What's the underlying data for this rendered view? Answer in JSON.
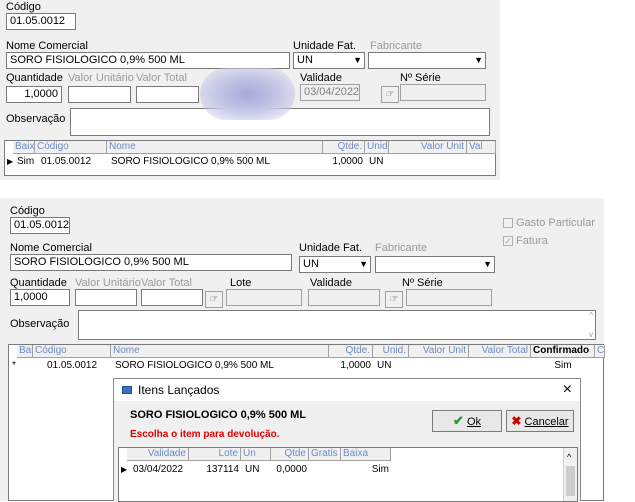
{
  "screen1": {
    "codigo_label": "Código",
    "codigo_value": "01.05.0012",
    "nome_label": "Nome Comercial",
    "nome_value": "SORO FISIOLOGICO 0,9% 500 ML",
    "unidade_label": "Unidade Fat.",
    "unidade_value": "UN",
    "fabricante_label": "Fabricante",
    "quantidade_label": "Quantidade",
    "quantidade_value": "1,0000",
    "valor_unit_label": "Valor Unitário",
    "valor_total_label": "Valor Total",
    "validade_label": "Validade",
    "validade_value": "03/04/2022",
    "serie_label": "Nº Série",
    "observacao_label": "Observação",
    "grid_headers": [
      "Baixa",
      "Código",
      "Nome",
      "Qtde.",
      "Unid.",
      "Valor Unit",
      "Val"
    ],
    "grid_row": [
      "Sim",
      "01.05.0012",
      "SORO FISIOLOGICO 0,9% 500 ML",
      "1,0000",
      "UN"
    ],
    "row_marker": "▶"
  },
  "screen2": {
    "codigo_label": "Código",
    "codigo_value": "01.05.0012",
    "nome_label": "Nome Comercial",
    "nome_value": "SORO FISIOLOGICO 0,9% 500 ML",
    "unidade_label": "Unidade Fat.",
    "unidade_value": "UN",
    "fabricante_label": "Fabricante",
    "gasto_label": "Gasto Particular",
    "fatura_label": "Fatura",
    "quantidade_label": "Quantidade",
    "quantidade_value": "1,0000",
    "valor_unit_label": "Valor Unitário",
    "valor_total_label": "Valor Total",
    "lote_label": "Lote",
    "validade_label": "Validade",
    "serie_label": "Nº Série",
    "observacao_label": "Observação",
    "grid_headers": [
      "Baixa",
      "Código",
      "Nome",
      "Qtde.",
      "Unid.",
      "Valor Unit",
      "Valor Total",
      "Confirmado",
      "Conf"
    ],
    "grid_row": [
      "01.05.0012",
      "SORO FISIOLOGICO 0,9% 500 ML",
      "1,0000",
      "UN",
      "Sim"
    ],
    "row_marker": "*"
  },
  "dialog": {
    "title": "Itens Lançados",
    "close": "×",
    "product": "SORO FISIOLOGICO 0,9% 500 ML",
    "instruction": "Escolha o item para devolução.",
    "ok_label": "Ok",
    "cancel_label": "Cancelar",
    "headers": [
      "Validade",
      "Lote",
      "Un",
      "Qtde",
      "Gratis",
      "Baixa"
    ],
    "row": [
      "03/04/2022",
      "137114",
      "UN",
      "0,0000",
      "",
      "Sim"
    ],
    "row_marker": "▶"
  }
}
